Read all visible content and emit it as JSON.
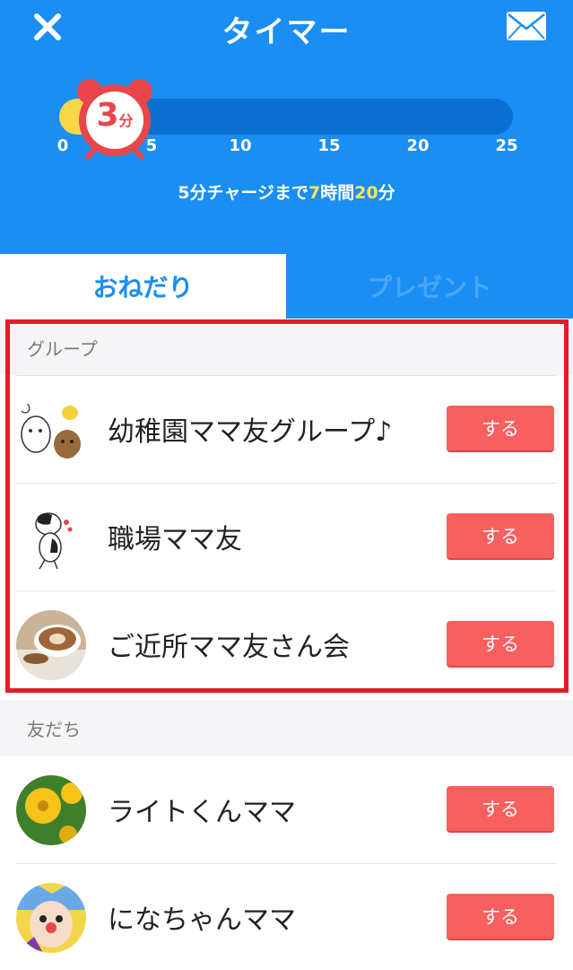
{
  "header": {
    "title": "タイマー",
    "close_icon": "close-icon",
    "mail_icon": "mail-icon"
  },
  "timer": {
    "current_value": "3",
    "current_unit": "分",
    "max_minutes": 25,
    "ticks": [
      "0",
      "5",
      "10",
      "15",
      "20",
      "25"
    ],
    "charge_prefix": "5分チャージまで",
    "charge_hours": "7",
    "charge_hours_label": "時間",
    "charge_minutes": "20",
    "charge_minutes_label": "分",
    "colors": {
      "bg": "#1a8ef2",
      "track": "#0b6fd0",
      "fill": "#f7d74a",
      "clock": "#e8464a"
    }
  },
  "tabs": [
    {
      "label": "おねだり",
      "active": true
    },
    {
      "label": "プレゼント",
      "active": false
    }
  ],
  "groups": {
    "header": "グループ",
    "items": [
      {
        "name": "幼稚園ママ友グループ♪",
        "button": "する",
        "avatar": "stickers-avatar"
      },
      {
        "name": "職場ママ友",
        "button": "する",
        "avatar": "cat-avatar"
      },
      {
        "name": "ご近所ママ友さん会",
        "button": "する",
        "avatar": "coffee-avatar"
      }
    ]
  },
  "friends": {
    "header": "友だち",
    "items": [
      {
        "name": "ライトくんママ",
        "button": "する",
        "avatar": "yellow-flower-avatar"
      },
      {
        "name": "になちゃんママ",
        "button": "する",
        "avatar": "clown-avatar"
      }
    ]
  },
  "accent_colors": {
    "button": "#f7605f",
    "highlight": "#e21c24"
  }
}
